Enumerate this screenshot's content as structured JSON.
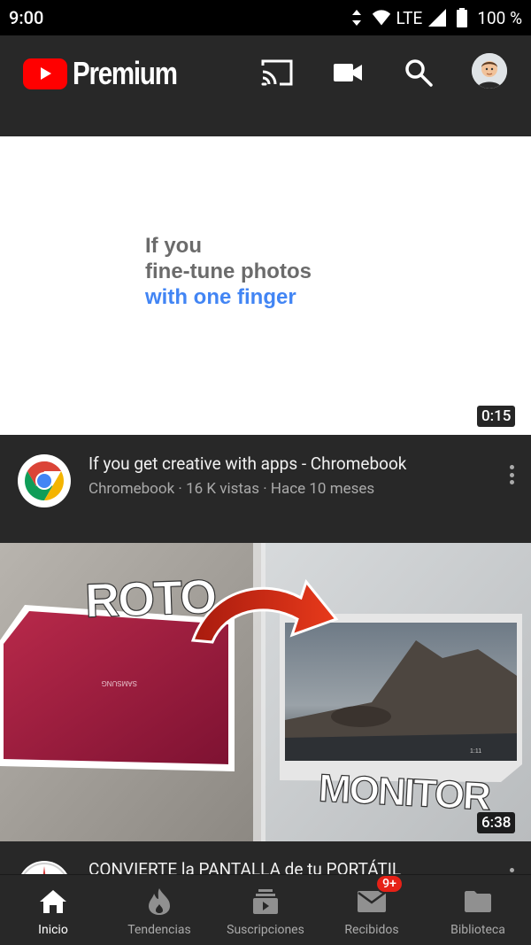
{
  "status_bar": {
    "time": "9:00",
    "network": "LTE",
    "battery": "100 %"
  },
  "header": {
    "brand": "Premium"
  },
  "ad": {
    "lines": [
      "If you",
      "fine-tune photos",
      "with one finger"
    ],
    "duration": "0:15",
    "title": "If you get creative with apps - Chromebook",
    "subtitle": "Chromebook · 16 K vistas · Hace 10 meses"
  },
  "video2": {
    "duration": "6:38",
    "overlay_top": "ROTO",
    "overlay_bottom": "MONITOR",
    "laptop_brand": "SAMSUNG",
    "screen_time": "1:11",
    "title": "CONVIERTE la PANTALLA de tu PORTÁTIL"
  },
  "nav": {
    "items": [
      {
        "label": "Inicio",
        "icon": "home-icon",
        "active": true
      },
      {
        "label": "Tendencias",
        "icon": "fire-icon"
      },
      {
        "label": "Suscripciones",
        "icon": "subscriptions-icon"
      },
      {
        "label": "Recibidos",
        "icon": "inbox-icon"
      },
      {
        "label": "Biblioteca",
        "icon": "library-icon"
      }
    ],
    "inbox_badge": "9+"
  },
  "colors": {
    "brand_red": "#ff0000",
    "accent_blue": "#4285f4",
    "badge_red": "#e62117"
  }
}
